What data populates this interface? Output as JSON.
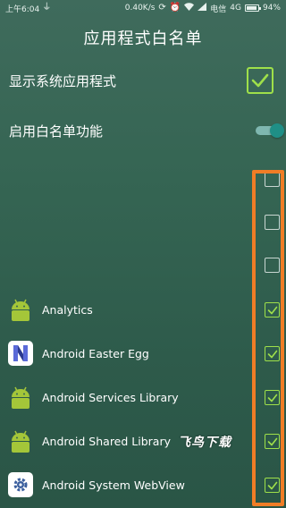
{
  "status_bar": {
    "time": "上午6:04",
    "net_speed": "0.40K/s",
    "carrier": "电信",
    "network": "4G",
    "battery": "94%",
    "battery_level": 0.94
  },
  "header": {
    "title": "应用程式白名单"
  },
  "settings": {
    "show_system_label": "显示系统应用程式",
    "show_system_checked": true,
    "whitelist_label": "启用白名单功能",
    "whitelist_enabled": true
  },
  "apps": [
    {
      "name": "",
      "icon": "none",
      "checked": false
    },
    {
      "name": "",
      "icon": "none",
      "checked": false
    },
    {
      "name": "",
      "icon": "none",
      "checked": false
    },
    {
      "name": "Analytics",
      "icon": "android-robot-icon",
      "checked": true
    },
    {
      "name": "Android Easter Egg",
      "icon": "android-n-icon",
      "checked": true
    },
    {
      "name": "Android Services Library",
      "icon": "android-robot-icon",
      "checked": true
    },
    {
      "name": "Android Shared Library",
      "icon": "android-robot-icon",
      "checked": true
    },
    {
      "name": "Android System WebView",
      "icon": "webview-gear-icon",
      "checked": true
    }
  ],
  "watermark": "飞鸟下载",
  "colors": {
    "background": "#356553",
    "check_accent": "#9fe04a",
    "toggle_thumb": "#1f8f86",
    "highlight": "#f07d26"
  }
}
